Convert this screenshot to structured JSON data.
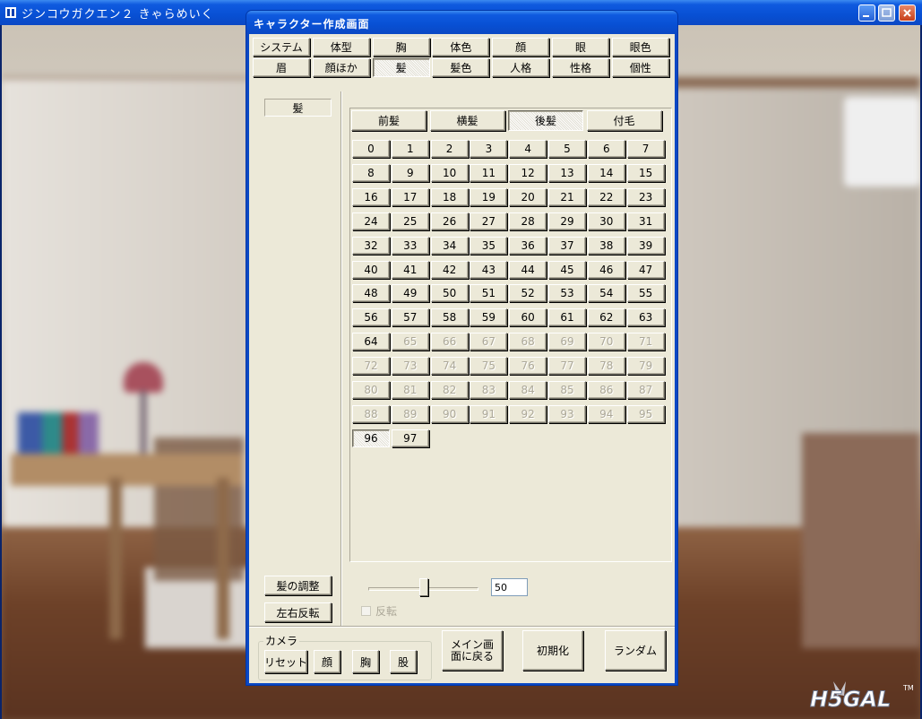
{
  "app": {
    "title": "ジンコウガクエン２ きゃらめいく"
  },
  "dialog": {
    "title": "キャラクター作成画面"
  },
  "category_tabs": {
    "row1": [
      "システム",
      "体型",
      "胸",
      "体色",
      "顔",
      "眼",
      "眼色"
    ],
    "row2": [
      "眉",
      "顔ほか",
      "髪",
      "髪色",
      "人格",
      "性格",
      "個性"
    ],
    "selected": "髪"
  },
  "left_panel": {
    "section_label": "髪",
    "adjust_label": "髪の調整",
    "flip_label": "左右反転"
  },
  "hair_tabs": {
    "items": [
      "前髪",
      "横髪",
      "後髪",
      "付毛"
    ],
    "selected": "後髪"
  },
  "hair_grid": {
    "enabled_max": 64,
    "extra_enabled": [
      "96",
      "97"
    ],
    "selected": "96",
    "rows": [
      [
        "0",
        "1",
        "2",
        "3",
        "4",
        "5",
        "6",
        "7"
      ],
      [
        "8",
        "9",
        "10",
        "11",
        "12",
        "13",
        "14",
        "15"
      ],
      [
        "16",
        "17",
        "18",
        "19",
        "20",
        "21",
        "22",
        "23"
      ],
      [
        "24",
        "25",
        "26",
        "27",
        "28",
        "29",
        "30",
        "31"
      ],
      [
        "32",
        "33",
        "34",
        "35",
        "36",
        "37",
        "38",
        "39"
      ],
      [
        "40",
        "41",
        "42",
        "43",
        "44",
        "45",
        "46",
        "47"
      ],
      [
        "48",
        "49",
        "50",
        "51",
        "52",
        "53",
        "54",
        "55"
      ],
      [
        "56",
        "57",
        "58",
        "59",
        "60",
        "61",
        "62",
        "63"
      ],
      [
        "64",
        "65",
        "66",
        "67",
        "68",
        "69",
        "70",
        "71"
      ],
      [
        "72",
        "73",
        "74",
        "75",
        "76",
        "77",
        "78",
        "79"
      ],
      [
        "80",
        "81",
        "82",
        "83",
        "84",
        "85",
        "86",
        "87"
      ],
      [
        "88",
        "89",
        "90",
        "91",
        "92",
        "93",
        "94",
        "95"
      ],
      [
        "96",
        "97"
      ]
    ]
  },
  "adjust": {
    "slider_value": 50,
    "slider_min": 0,
    "slider_max": 100,
    "value_text": "50",
    "flip_checkbox_label": "反転",
    "flip_checked": false
  },
  "camera": {
    "legend": "カメラ",
    "buttons": [
      "リセット",
      "顔",
      "胸",
      "股"
    ]
  },
  "footer_buttons": {
    "main_menu": "メイン画面に戻る",
    "init": "初期化",
    "random": "ランダム"
  },
  "watermark": {
    "text": "H5GAL",
    "tm": "TM"
  },
  "colors": {
    "titlebar": "#0a5ad4",
    "dialog_face": "#ece9d8",
    "disabled_text": "#aca899"
  }
}
